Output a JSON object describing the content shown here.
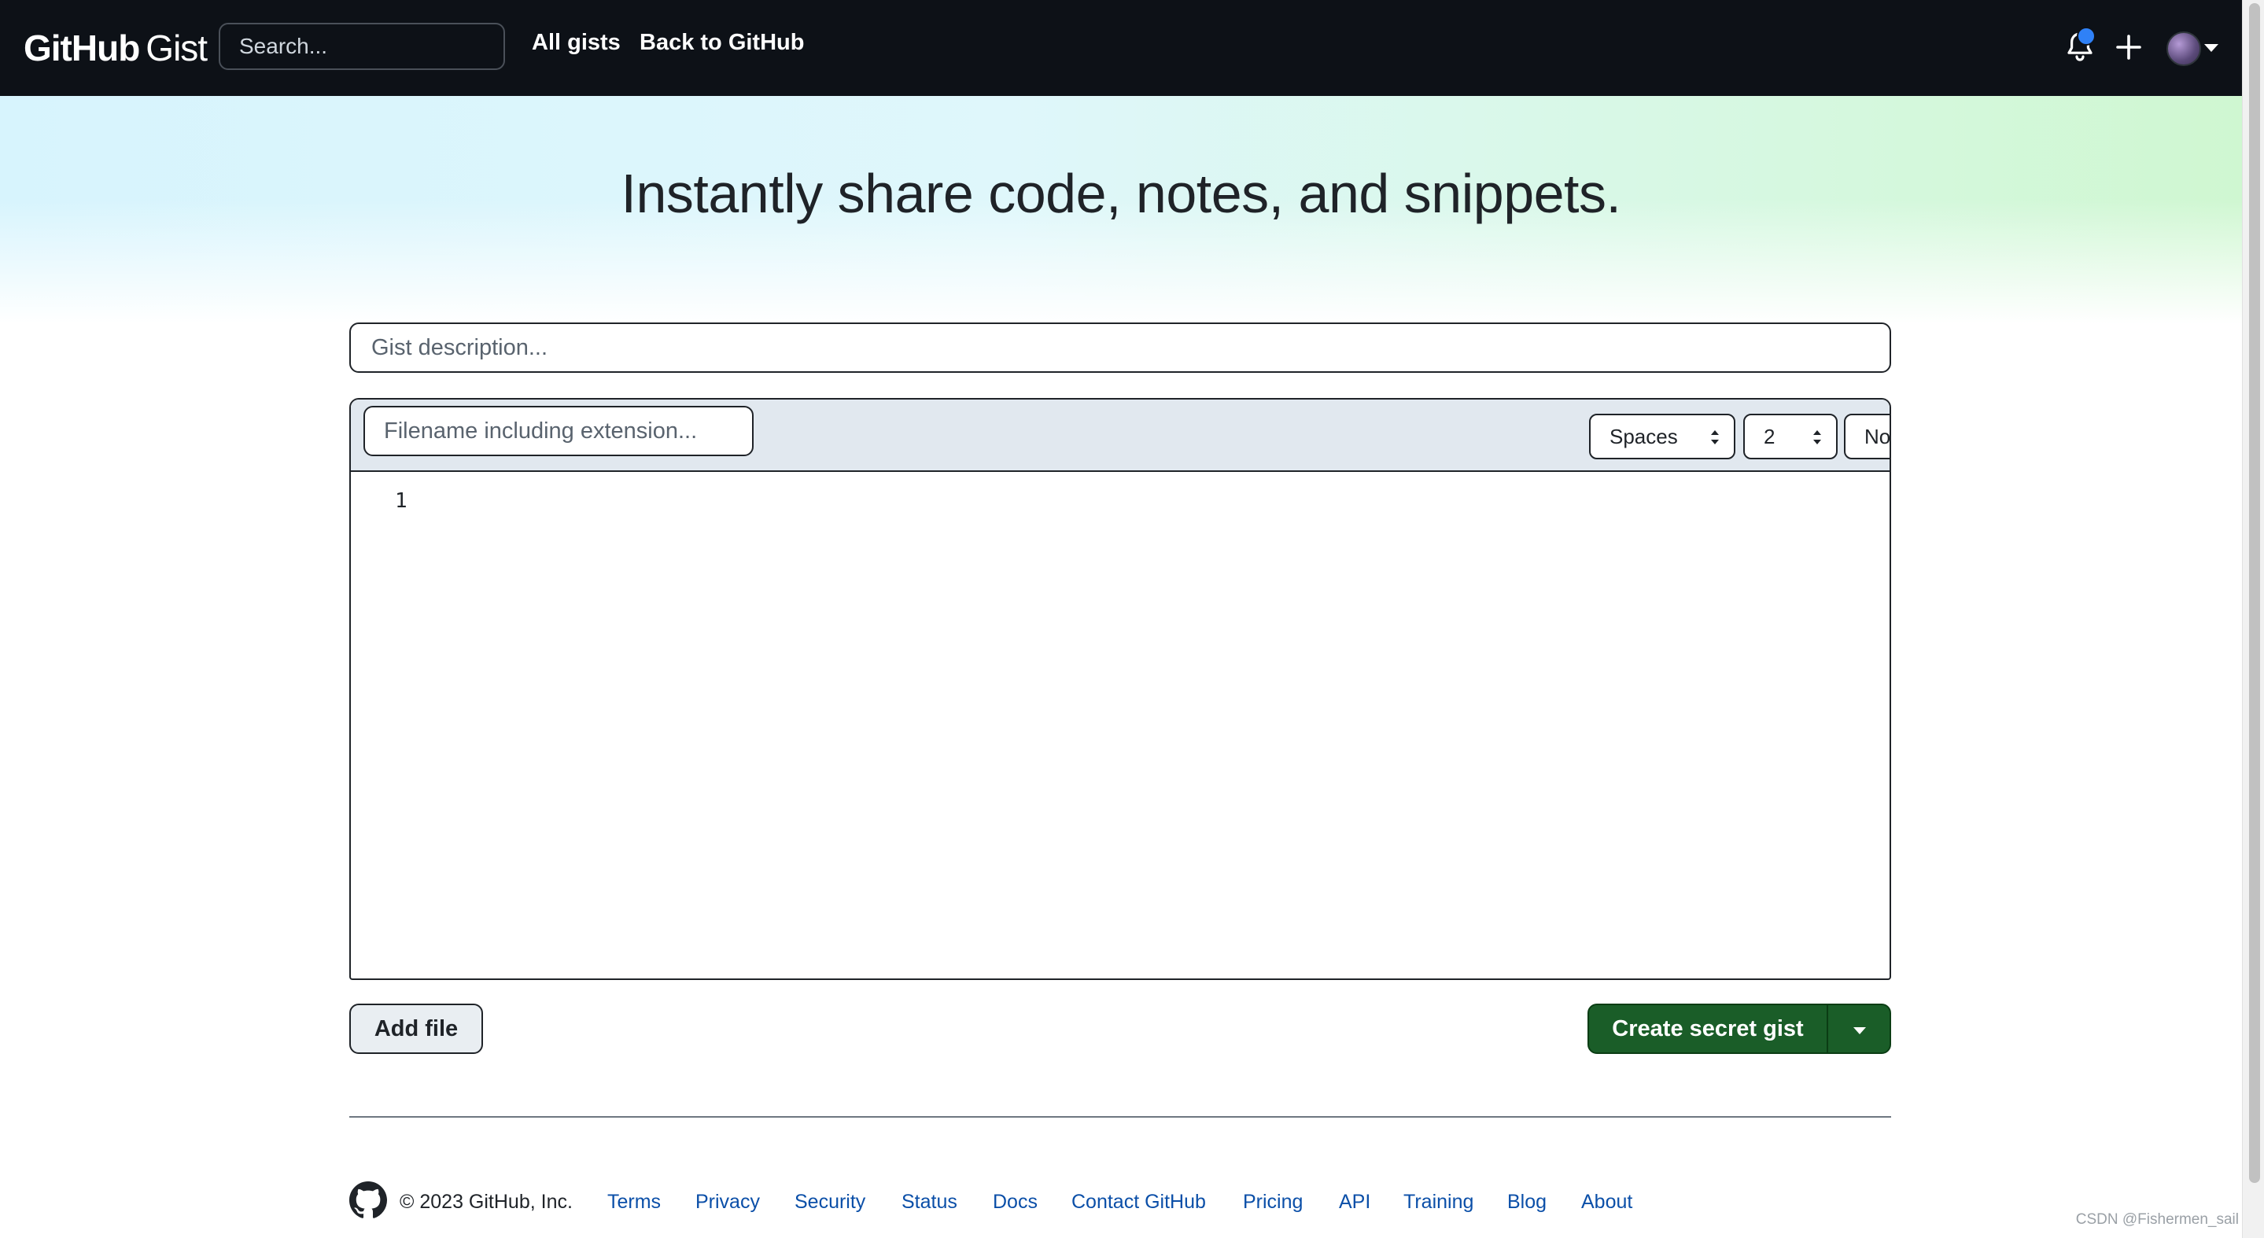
{
  "header": {
    "logo_bold": "GitHub",
    "logo_light": "Gist",
    "search_placeholder": "Search...",
    "nav": [
      "All gists",
      "Back to GitHub"
    ]
  },
  "hero": {
    "title": "Instantly share code, notes, and snippets."
  },
  "form": {
    "description_placeholder": "Gist description...",
    "filename_placeholder": "Filename including extension...",
    "indent_mode": "Spaces",
    "indent_size": "2",
    "wrap_mode": "No wrap",
    "line_numbers": [
      "1"
    ]
  },
  "actions": {
    "add_file": "Add file",
    "create": "Create secret gist"
  },
  "footer": {
    "copyright": "© 2023 GitHub, Inc.",
    "links": [
      "Terms",
      "Privacy",
      "Security",
      "Status",
      "Docs",
      "Contact GitHub",
      "Pricing",
      "API",
      "Training",
      "Blog",
      "About"
    ]
  },
  "watermark": "CSDN @Fishermen_sail",
  "colors": {
    "header_bg": "#0d1117",
    "primary_button": "#1a5d28",
    "link": "#0b4fa8",
    "notification_dot": "#2f81f7"
  },
  "icons": [
    "bell-icon",
    "plus-icon",
    "avatar",
    "chevron-down-icon",
    "github-mark-icon"
  ]
}
